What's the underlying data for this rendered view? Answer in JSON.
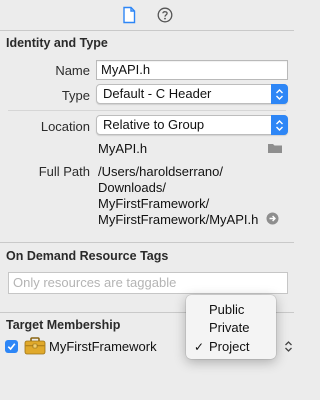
{
  "tabs": [
    {
      "name": "file-inspector",
      "icon": "document-icon",
      "active": true
    },
    {
      "name": "quick-help",
      "icon": "help-icon",
      "active": false
    }
  ],
  "identity": {
    "header": "Identity and Type",
    "name_label": "Name",
    "name_value": "MyAPI.h",
    "type_label": "Type",
    "type_value": "Default - C Header",
    "location_label": "Location",
    "location_value": "Relative to Group",
    "location_filename": "MyAPI.h",
    "full_path_label": "Full Path",
    "full_path_lines": [
      "/Users/haroldserrano/",
      "Downloads/",
      "MyFirstFramework/",
      "MyFirstFramework/MyAPI.h"
    ]
  },
  "tags": {
    "header": "On Demand Resource Tags",
    "placeholder": "Only resources are taggable"
  },
  "membership": {
    "header": "Target Membership",
    "target_name": "MyFirstFramework",
    "target_checked": true
  },
  "visibility_menu": {
    "options": [
      "Public",
      "Private",
      "Project"
    ],
    "selected": "Project"
  },
  "colors": {
    "accent": "#2d86f6",
    "panel_bg": "#ececec"
  }
}
